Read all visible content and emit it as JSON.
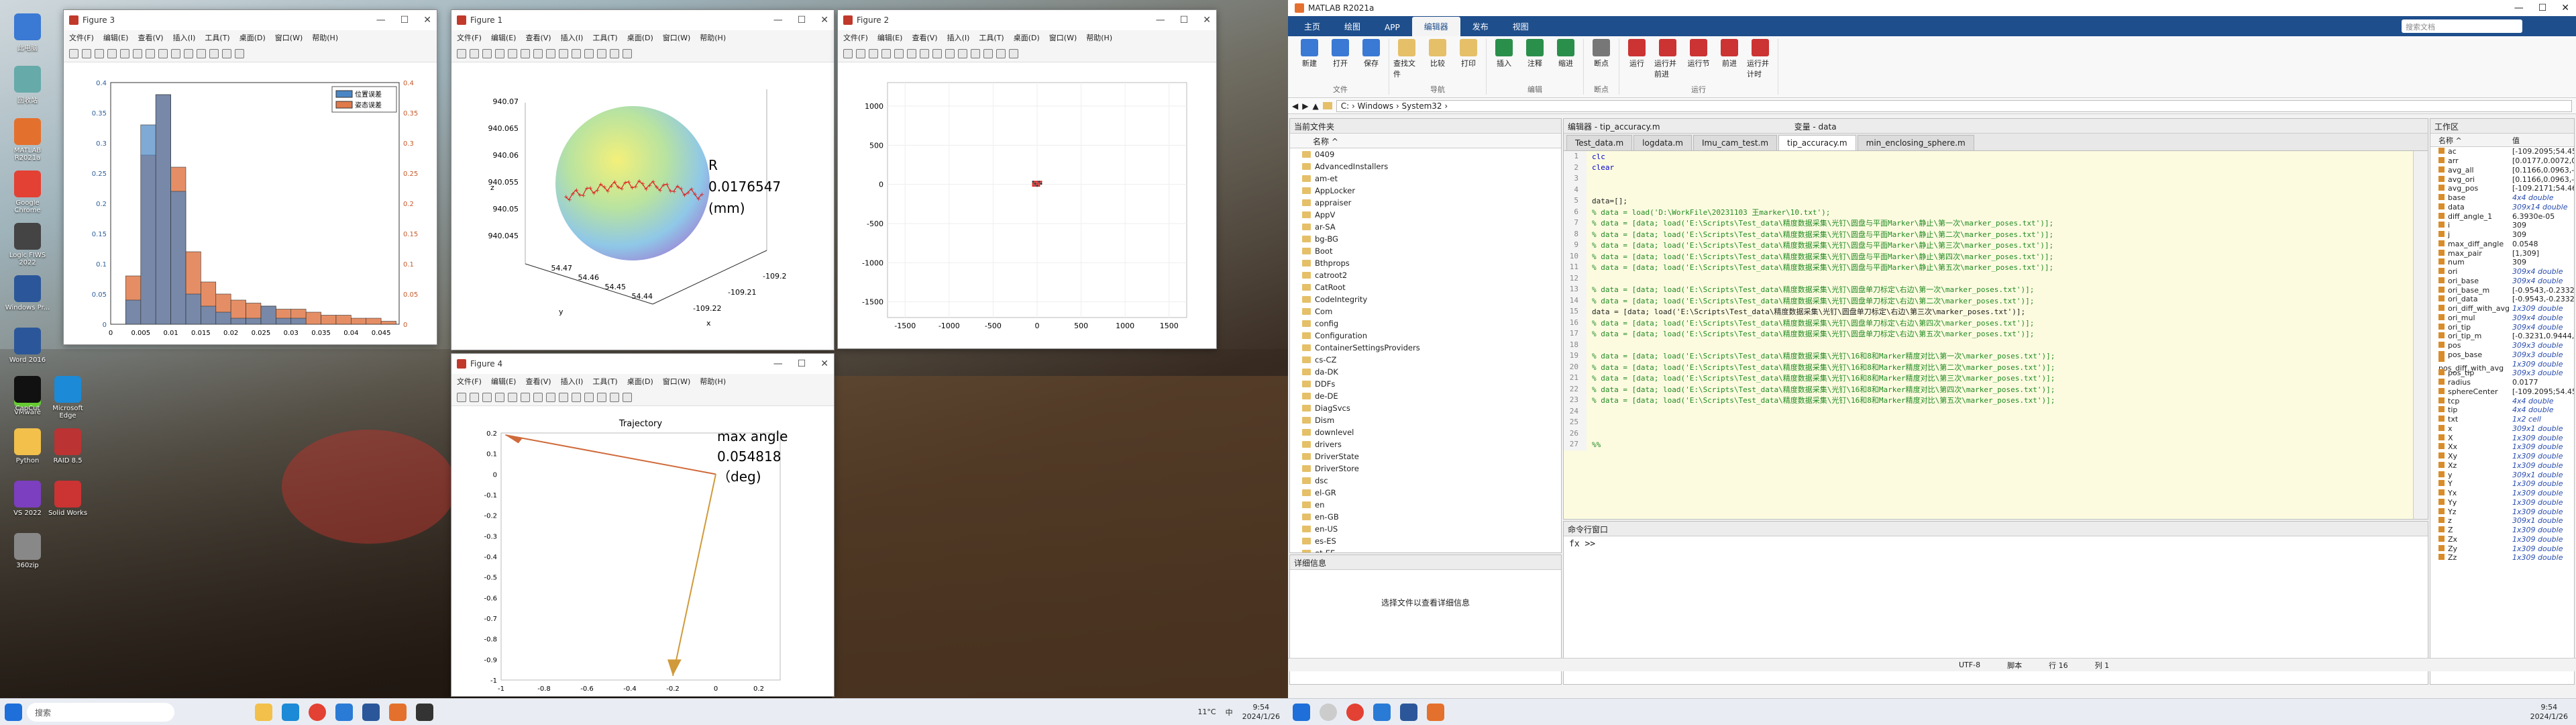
{
  "desktop": {
    "icons": [
      "此电脑",
      "回收站",
      "MATLAB R2021a",
      "Google Chrome",
      "Logic FIWS 2022",
      "Windows Pr...",
      "Word 2016",
      "VMware",
      "CapCut",
      "Microsoft Edge",
      "Python",
      "RAID 8.5",
      "VS 2022",
      "Solid Works",
      "360zip"
    ]
  },
  "figure3": {
    "title": "Figure 3",
    "menu": [
      "文件(F)",
      "编辑(E)",
      "查看(V)",
      "插入(I)",
      "工具(T)",
      "桌面(D)",
      "窗口(W)",
      "帮助(H)"
    ],
    "legend": [
      "位置误差",
      "姿态误差"
    ],
    "color_a": "#4a86c5",
    "color_b": "#e07a4a"
  },
  "figure1": {
    "title": "Figure 1",
    "menu": [
      "文件(F)",
      "编辑(E)",
      "查看(V)",
      "插入(I)",
      "工具(T)",
      "桌面(D)",
      "窗口(W)",
      "帮助(H)"
    ],
    "annot_r": "R",
    "annot_val": "0.0176547",
    "annot_unit": "(mm)"
  },
  "figure2": {
    "title": "Figure 2",
    "menu": [
      "文件(F)",
      "编辑(E)",
      "查看(V)",
      "插入(I)",
      "工具(T)",
      "桌面(D)",
      "窗口(W)",
      "帮助(H)"
    ]
  },
  "figure4": {
    "title": "Figure 4",
    "menu": [
      "文件(F)",
      "编辑(E)",
      "查看(V)",
      "插入(I)",
      "工具(T)",
      "桌面(D)",
      "窗口(W)",
      "帮助(H)"
    ],
    "annot_a": "max angle",
    "annot_b": "0.054818",
    "annot_c": "（deg)"
  },
  "chart_data": [
    {
      "type": "bar",
      "title": "",
      "x_ticks": [
        "0",
        "0.005",
        "0.01",
        "0.015",
        "0.02",
        "0.025",
        "0.03",
        "0.035",
        "0.04",
        "0.045"
      ],
      "y_left_ticks": [
        "0",
        "0.05",
        "0.1",
        "0.15",
        "0.2",
        "0.25",
        "0.3",
        "0.35",
        "0.4"
      ],
      "y_right_ticks": [
        "0",
        "0.05",
        "0.1",
        "0.15",
        "0.2",
        "0.25",
        "0.3",
        "0.35",
        "0.4"
      ],
      "series": [
        {
          "name": "位置误差",
          "bin_edges": [
            0.0025,
            0.005,
            0.0075,
            0.01,
            0.0125,
            0.015,
            0.0175,
            0.02,
            0.0225,
            0.025,
            0.0275,
            0.03,
            0.0325
          ],
          "values": [
            0.04,
            0.33,
            0.38,
            0.22,
            0.05,
            0.03,
            0.02,
            0.01,
            0.01,
            0.03,
            0.01,
            0.01
          ]
        },
        {
          "name": "姿态误差",
          "bin_edges": [
            0.0025,
            0.005,
            0.0075,
            0.01,
            0.0125,
            0.015,
            0.0175,
            0.02,
            0.0225,
            0.025,
            0.0275,
            0.03,
            0.0325,
            0.035,
            0.0375,
            0.04,
            0.0425,
            0.045,
            0.0475
          ],
          "values": [
            0.08,
            0.28,
            0.38,
            0.26,
            0.12,
            0.07,
            0.05,
            0.04,
            0.035,
            0.03,
            0.025,
            0.025,
            0.02,
            0.015,
            0.015,
            0.01,
            0.01,
            0.005
          ]
        }
      ]
    },
    {
      "type": "scatter",
      "title": "",
      "zlabel": "z",
      "ylabel": "y",
      "xlabel": "x",
      "z_ticks": [
        "940.045",
        "940.05",
        "940.055",
        "940.06",
        "940.065",
        "940.07"
      ],
      "y_ticks": [
        "54.44",
        "54.45",
        "54.46",
        "54.47"
      ],
      "x_ticks": [
        "-109.22",
        "-109.21",
        "-109.2"
      ]
    },
    {
      "type": "scatter",
      "title": "",
      "x_ticks": [
        "-1500",
        "-1000",
        "-500",
        "0",
        "500",
        "1000",
        "1500"
      ],
      "y_ticks": [
        "-1500",
        "-1000",
        "-500",
        "0",
        "500",
        "1000"
      ]
    },
    {
      "type": "line",
      "title": "Trajectory",
      "x_ticks": [
        "-1",
        "-0.8",
        "-0.6",
        "-0.4",
        "-0.2",
        "0",
        "0.2"
      ],
      "y_ticks": [
        "-1",
        "-0.9",
        "-0.8",
        "-0.7",
        "-0.6",
        "-0.5",
        "-0.4",
        "-0.3",
        "-0.2",
        "-0.1",
        "0",
        "0.1",
        "0.2"
      ],
      "xlim": [
        -1,
        0.3
      ],
      "ylim": [
        -1,
        0.2
      ]
    }
  ],
  "matlab": {
    "title": "MATLAB R2021a",
    "tabs": [
      "主页",
      "绘图",
      "APP",
      "编辑器",
      "发布",
      "视图"
    ],
    "search_placeholder": "搜索文档",
    "ribbon_groups": [
      {
        "label": "文件",
        "buttons": [
          "新建",
          "打开",
          "保存"
        ]
      },
      {
        "label": "导航",
        "buttons": [
          "查找文件",
          "比较",
          "打印"
        ]
      },
      {
        "label": "编辑",
        "buttons": [
          "插入",
          "注释",
          "缩进"
        ]
      },
      {
        "label": "断点",
        "buttons": [
          "断点"
        ]
      },
      {
        "label": "运行",
        "buttons": [
          "运行",
          "运行并前进",
          "运行节",
          "前进",
          "运行并计时"
        ]
      }
    ],
    "address": "C: › Windows › System32 ›",
    "current_folder": "当前文件夹",
    "folder_col": "名称 ^",
    "folders": [
      "0409",
      "AdvancedInstallers",
      "am-et",
      "AppLocker",
      "appraiser",
      "AppV",
      "ar-SA",
      "bg-BG",
      "Boot",
      "Bthprops",
      "catroot2",
      "CatRoot",
      "CodeIntegrity",
      "Com",
      "config",
      "Configuration",
      "ContainerSettingsProviders",
      "cs-CZ",
      "da-DK",
      "DDFs",
      "de-DE",
      "DiagSvcs",
      "Dism",
      "downlevel",
      "drivers",
      "DriverState",
      "DriverStore",
      "dsc",
      "el-GR",
      "en",
      "en-GB",
      "en-US",
      "es-ES",
      "et-EE"
    ],
    "details": "详细信息",
    "details_empty": "选择文件以查看详细信息",
    "editor_title": "编辑器 - tip_accuracy.m",
    "var_title": "变量 - data",
    "editor_tabs": [
      "Test_data.m",
      "logdata.m",
      "Imu_cam_test.m",
      "tip_accuracy.m",
      "min_enclosing_sphere.m"
    ],
    "code_lines": [
      "clc",
      "clear",
      "",
      "",
      "data=[];",
      "% data = load('D:\\WorkFile\\20231103 王marker\\10.txt');",
      "% data = [data; load('E:\\Scripts\\Test_data\\精度数据采集\\光钉\\圆盘与平面Marker\\静止\\第一次\\marker_poses.txt')];",
      "% data = [data; load('E:\\Scripts\\Test_data\\精度数据采集\\光钉\\圆盘与平面Marker\\静止\\第二次\\marker_poses.txt')];",
      "% data = [data; load('E:\\Scripts\\Test_data\\精度数据采集\\光钉\\圆盘与平面Marker\\静止\\第三次\\marker_poses.txt')];",
      "% data = [data; load('E:\\Scripts\\Test_data\\精度数据采集\\光钉\\圆盘与平面Marker\\静止\\第四次\\marker_poses.txt')];",
      "% data = [data; load('E:\\Scripts\\Test_data\\精度数据采集\\光钉\\圆盘与平面Marker\\静止\\第五次\\marker_poses.txt')];",
      "",
      "% data = [data; load('E:\\Scripts\\Test_data\\精度数据采集\\光钉\\圆盘单刀标定\\右边\\第一次\\marker_poses.txt')];",
      "% data = [data; load('E:\\Scripts\\Test_data\\精度数据采集\\光钉\\圆盘单刀标定\\右边\\第二次\\marker_poses.txt')];",
      "data = [data; load('E:\\Scripts\\Test_data\\精度数据采集\\光钉\\圆盘单刀标定\\右边\\第三次\\marker_poses.txt')];",
      "% data = [data; load('E:\\Scripts\\Test_data\\精度数据采集\\光钉\\圆盘单刀标定\\右边\\第四次\\marker_poses.txt')];",
      "% data = [data; load('E:\\Scripts\\Test_data\\精度数据采集\\光钉\\圆盘单刀标定\\右边\\第五次\\marker_poses.txt')];",
      "",
      "% data = [data; load('E:\\Scripts\\Test_data\\精度数据采集\\光钉\\16和8和Marker精度对比\\第一次\\marker_poses.txt')];",
      "% data = [data; load('E:\\Scripts\\Test_data\\精度数据采集\\光钉\\16和8和Marker精度对比\\第二次\\marker_poses.txt')];",
      "% data = [data; load('E:\\Scripts\\Test_data\\精度数据采集\\光钉\\16和8和Marker精度对比\\第三次\\marker_poses.txt')];",
      "% data = [data; load('E:\\Scripts\\Test_data\\精度数据采集\\光钉\\16和8和Marker精度对比\\第四次\\marker_poses.txt')];",
      "% data = [data; load('E:\\Scripts\\Test_data\\精度数据采集\\光钉\\16和8和Marker精度对比\\第五次\\marker_poses.txt')];",
      "",
      "",
      "",
      "%%"
    ],
    "command_title": "命令行窗口",
    "prompt": "fx >>",
    "workspace_title": "工作区",
    "ws_cols": [
      "名称 ^",
      "值"
    ],
    "workspace": [
      [
        "ac",
        "[-109.2095;54.4535;..."
      ],
      [
        "arr",
        "[0.0177,0.0072,0.00..."
      ],
      [
        "avg_all",
        "[0.1166,0.0963,-0.0..."
      ],
      [
        "avg_ori",
        "[0.1166,0.0963,-0.0..."
      ],
      [
        "avg_pos",
        "[-109.2171;54.4605;..."
      ],
      [
        "base",
        "4x4 double"
      ],
      [
        "data",
        "309x14 double"
      ],
      [
        "diff_angle_1",
        "6.3930e-05"
      ],
      [
        "i",
        "309"
      ],
      [
        "j",
        "309"
      ],
      [
        "max_diff_angle",
        "0.0548"
      ],
      [
        "max_pair",
        "[1,309]"
      ],
      [
        "num",
        "309"
      ],
      [
        "ori",
        "309x4 double"
      ],
      [
        "ori_base",
        "309x4 double"
      ],
      [
        "ori_base_m",
        "[-0.9543,-0.2332,0.1..."
      ],
      [
        "ori_data",
        "[-0.9543,-0.2332,0.1..."
      ],
      [
        "ori_diff_with_avg",
        "1x309 double"
      ],
      [
        "ori_mul",
        "309x4 double"
      ],
      [
        "ori_tip",
        "309x4 double"
      ],
      [
        "ori_tip_m",
        "[-0.3231,0.9444,0.0..."
      ],
      [
        "pos",
        "309x3 double"
      ],
      [
        "pos_base",
        "309x3 double"
      ],
      [
        "pos_diff_with_avg",
        "1x309 double"
      ],
      [
        "pos_tip",
        "309x3 double"
      ],
      [
        "radius",
        "0.0177"
      ],
      [
        "sphereCenter",
        "[-109.2095;54.4535;..."
      ],
      [
        "tcp",
        "4x4 double"
      ],
      [
        "tip",
        "4x4 double"
      ],
      [
        "txt",
        "1x2 cell"
      ],
      [
        "x",
        "309x1 double"
      ],
      [
        "X",
        "1x309 double"
      ],
      [
        "Xx",
        "1x309 double"
      ],
      [
        "Xy",
        "1x309 double"
      ],
      [
        "Xz",
        "1x309 double"
      ],
      [
        "y",
        "309x1 double"
      ],
      [
        "Y",
        "1x309 double"
      ],
      [
        "Yx",
        "1x309 double"
      ],
      [
        "Yy",
        "1x309 double"
      ],
      [
        "Yz",
        "1x309 double"
      ],
      [
        "z",
        "309x1 double"
      ],
      [
        "Z",
        "1x309 double"
      ],
      [
        "Zx",
        "1x309 double"
      ],
      [
        "Zy",
        "1x309 double"
      ],
      [
        "Zz",
        "1x309 double"
      ]
    ],
    "status_enc": "UTF-8",
    "status_type": "脚本",
    "status_line": "行 16",
    "status_col": "列 1"
  },
  "taskbar": {
    "search": "搜索",
    "time1": "9:54",
    "date1": "2024/1/26",
    "time2": "9:54",
    "date2": "2024/1/26",
    "lang": "中",
    "weather": "11°C"
  }
}
